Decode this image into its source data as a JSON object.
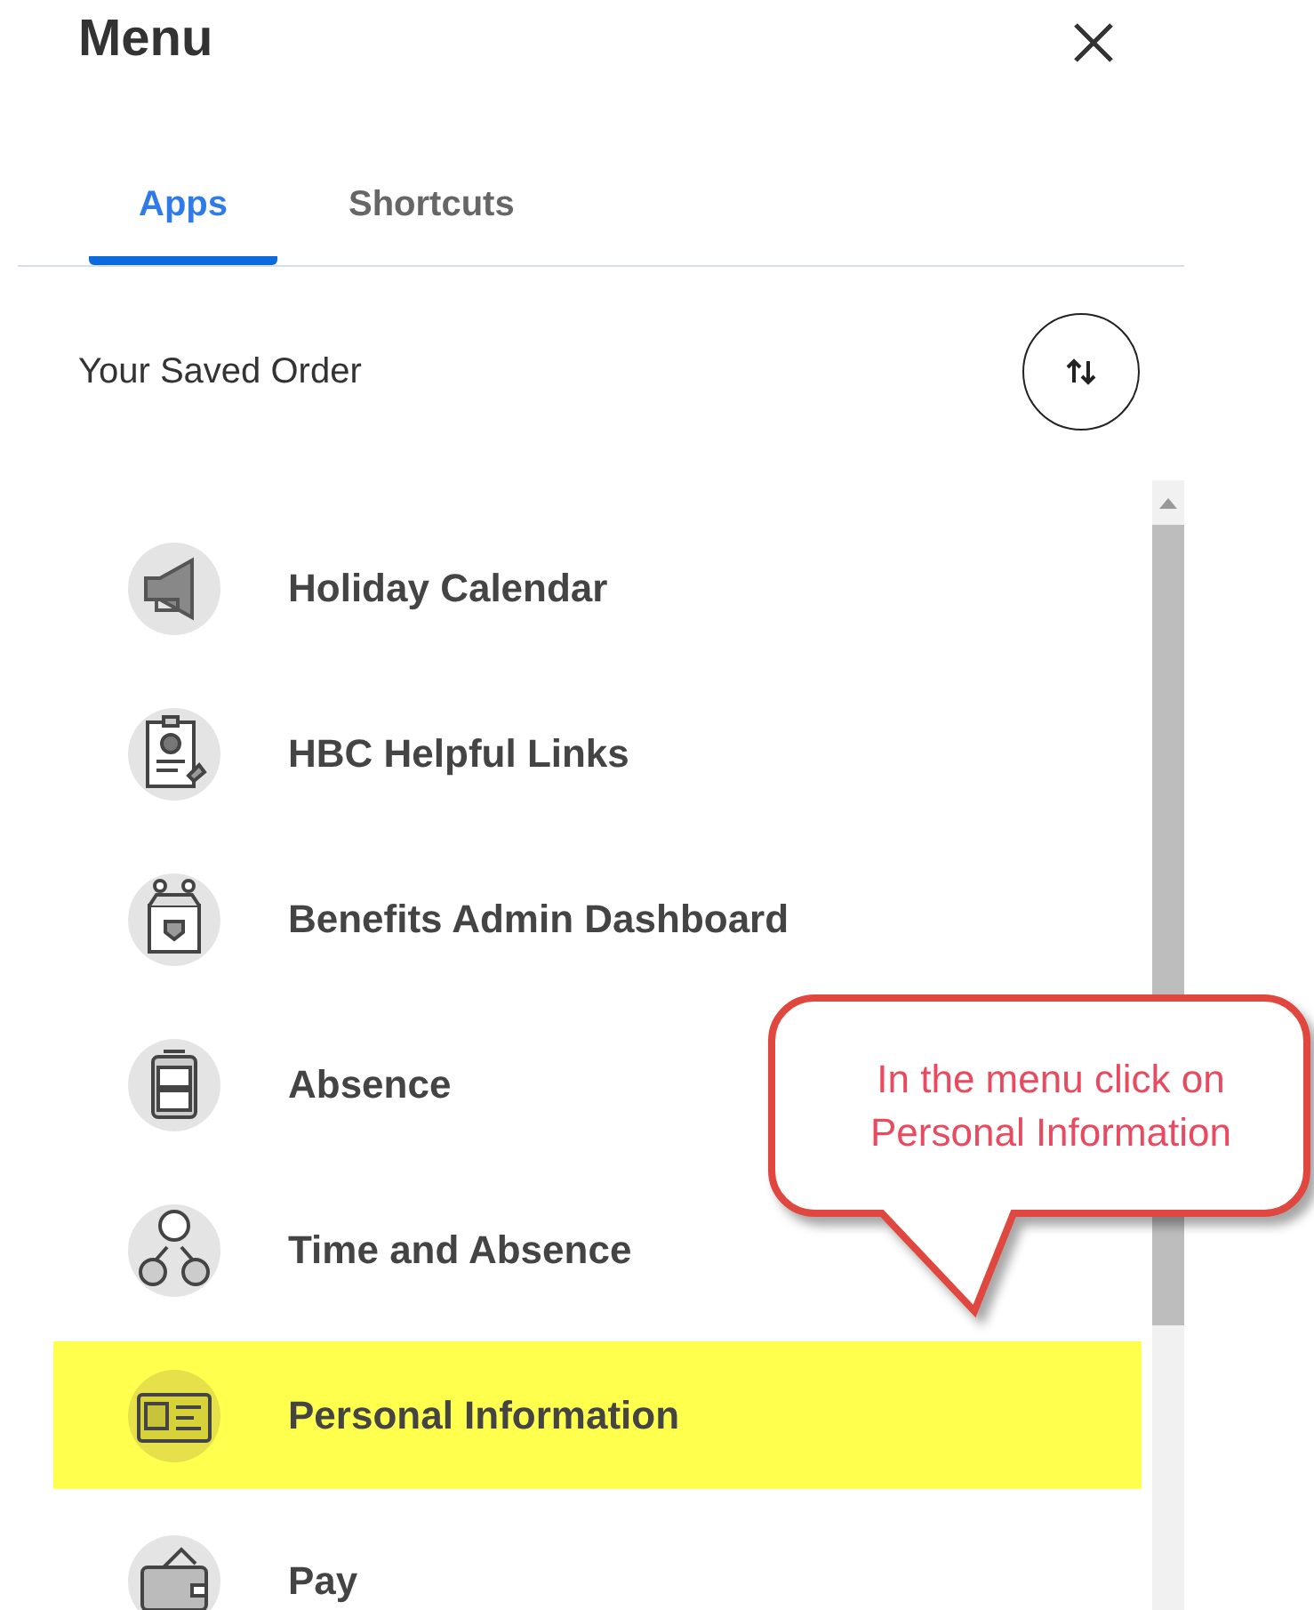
{
  "title": "Menu",
  "tabs": [
    {
      "label": "Apps",
      "selected": true
    },
    {
      "label": "Shortcuts",
      "selected": false
    }
  ],
  "section_label": "Your Saved Order",
  "items": [
    {
      "label": "Holiday Calendar",
      "highlighted": false
    },
    {
      "label": "HBC Helpful Links",
      "highlighted": false
    },
    {
      "label": "Benefits Admin Dashboard",
      "highlighted": false
    },
    {
      "label": "Absence",
      "highlighted": false
    },
    {
      "label": "Time and Absence",
      "highlighted": false
    },
    {
      "label": "Personal Information",
      "highlighted": true
    },
    {
      "label": "Pay",
      "highlighted": false
    }
  ],
  "callout": {
    "lines": [
      "In the menu click on",
      "Personal Information"
    ]
  }
}
